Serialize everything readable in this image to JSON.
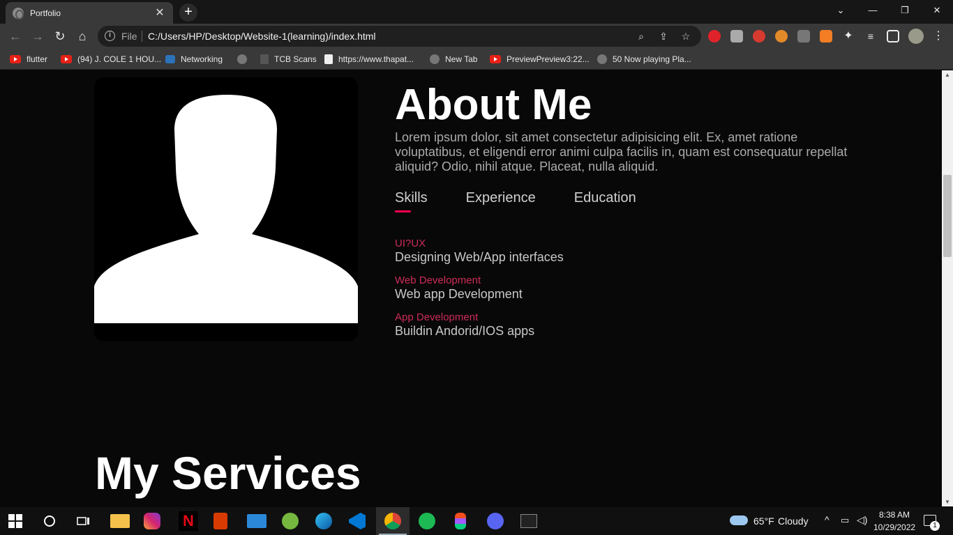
{
  "browser": {
    "tab_title": "Portfolio",
    "tab_close": "✕",
    "new_tab": "+",
    "address_prefix": "File",
    "address_url": "C:/Users/HP/Desktop/Website-1(learning)/index.html",
    "bookmarks": [
      {
        "label": "flutter",
        "icon": "youtube-icon"
      },
      {
        "label": "(94) J. COLE 1 HOU...",
        "icon": "youtube-icon"
      },
      {
        "label": "Networking",
        "icon": "network-icon"
      },
      {
        "label": "",
        "icon": "globe-icon"
      },
      {
        "label": "TCB Scans",
        "icon": "page-icon"
      },
      {
        "label": "https://www.thapat...",
        "icon": "page-icon"
      },
      {
        "label": "New Tab",
        "icon": "globe-icon"
      },
      {
        "label": "PreviewPreview3:22...",
        "icon": "youtube-icon"
      },
      {
        "label": "50 Now playing Pla...",
        "icon": "globe-icon"
      }
    ]
  },
  "about": {
    "title": "About Me",
    "text": "Lorem ipsum dolor, sit amet consectetur adipisicing elit. Ex, amet ratione voluptatibus, et eligendi error animi culpa facilis in, quam est consequatur repellat aliquid? Odio, nihil atque. Placeat, nulla aliquid.",
    "tabs": [
      "Skills",
      "Experience",
      "Education"
    ],
    "active_tab": "Skills",
    "accent_color": "#ff004f",
    "skills": [
      {
        "title": "UI?UX",
        "desc": "Designing Web/App interfaces"
      },
      {
        "title": "Web Development",
        "desc": "Web app Development"
      },
      {
        "title": "App Development",
        "desc": "Buildin Andorid/IOS apps"
      }
    ]
  },
  "services": {
    "title": "My Services"
  },
  "taskbar": {
    "weather_temp": "65°F",
    "weather_desc": "Cloudy",
    "time": "8:38 AM",
    "date": "10/29/2022",
    "notification_count": "1",
    "apps": [
      "file-explorer-icon",
      "instagram-icon",
      "netflix-icon",
      "office-icon",
      "mail-icon",
      "utorrent-icon",
      "edge-icon",
      "vscode-icon",
      "chrome-icon",
      "spotify-icon",
      "figma-icon",
      "discord-icon",
      "terminal-icon"
    ]
  }
}
